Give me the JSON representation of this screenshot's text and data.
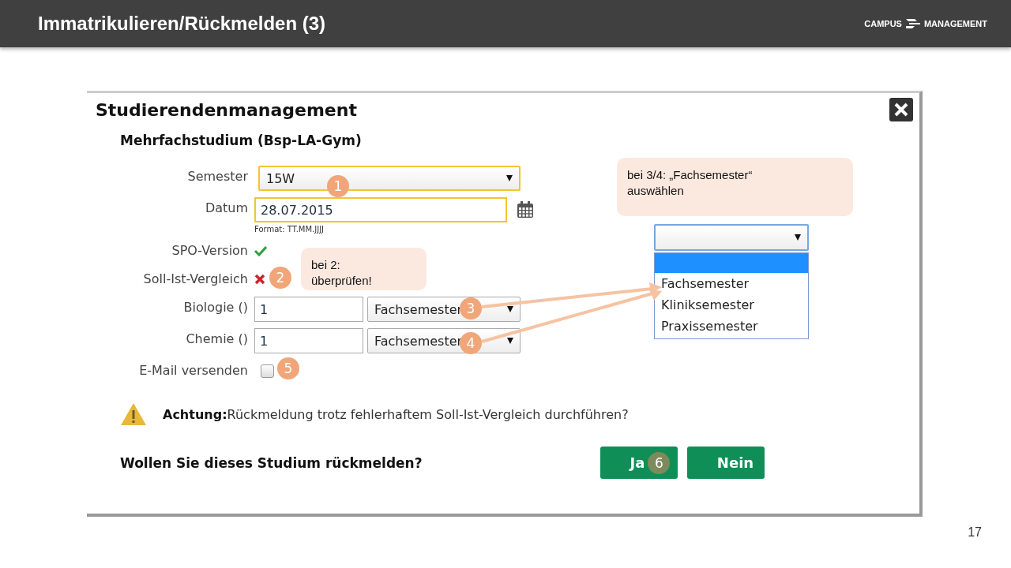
{
  "header": {
    "title": "Immatrikulieren/Rückmelden (3)",
    "logo_left": "CAMPUS",
    "logo_right": "MANAGEMENT"
  },
  "dialog": {
    "title": "Studierendenmanagement",
    "subtitle": "Mehrfachstudium (Bsp-LA-Gym)",
    "fields": [
      {
        "kind": "select",
        "label": "Semester",
        "value": "15W",
        "highlighted": true
      },
      {
        "kind": "date",
        "label": "Datum",
        "value": "28.07.2015",
        "hint": "Format: TT.MM.JJJJ",
        "highlighted": true
      },
      {
        "kind": "status",
        "label": "SPO-Version",
        "ok": true
      },
      {
        "kind": "status",
        "label": "Soll-Ist-Vergleich",
        "ok": false
      },
      {
        "kind": "pair",
        "label": "Biologie ()",
        "value": "1",
        "option": "Fachsemester"
      },
      {
        "kind": "pair",
        "label": "Chemie ()",
        "value": "1",
        "option": "Fachsemester"
      },
      {
        "kind": "checkbox",
        "label": "E-Mail versenden",
        "checked": false
      }
    ],
    "warning": "**Achtung:**Rückmeldung trotz fehlerhaftem Soll-Ist-Vergleich durchführen?",
    "question": "Wollen Sie dieses Studium rückmelden?",
    "buttons": [
      "Ja",
      "Nein"
    ],
    "dropdown": {
      "blank_option_highlighted": true,
      "options": [
        {
          "label": "Fachsemester"
        },
        {
          "label": "Kliniksemester"
        },
        {
          "label": "Praxissemester"
        }
      ]
    }
  },
  "callouts": [
    {
      "text": "bei 3/4: „Fachsemester“\nauswählen"
    },
    {
      "text": "bei 2:\nüberprüfen!"
    }
  ],
  "markers": [
    {
      "label": "1",
      "color": "#f0a678"
    },
    {
      "label": "2",
      "color": "#f0a678"
    },
    {
      "label": "3",
      "color": "#f0a678"
    },
    {
      "label": "4",
      "color": "#f0a678"
    },
    {
      "label": "5",
      "color": "#f0a678"
    },
    {
      "label": "6",
      "color": "#7d8a5c"
    }
  ],
  "slide_number": "17"
}
